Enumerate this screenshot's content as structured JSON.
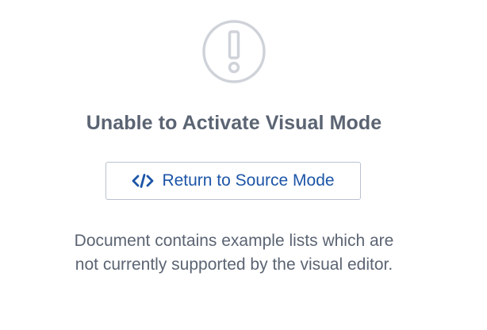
{
  "alert": {
    "icon": "exclamation-circle-icon",
    "title": "Unable to Activate Visual Mode"
  },
  "return_button": {
    "icon": "code-icon",
    "label": "Return to Source Mode"
  },
  "message": {
    "line1": "Document contains example lists which are",
    "line2": "not currently supported by the visual editor."
  },
  "colors": {
    "text": "#5b6473",
    "accent": "#1c55a7",
    "border": "#b9c2cf",
    "icon": "#cfd3d9"
  }
}
